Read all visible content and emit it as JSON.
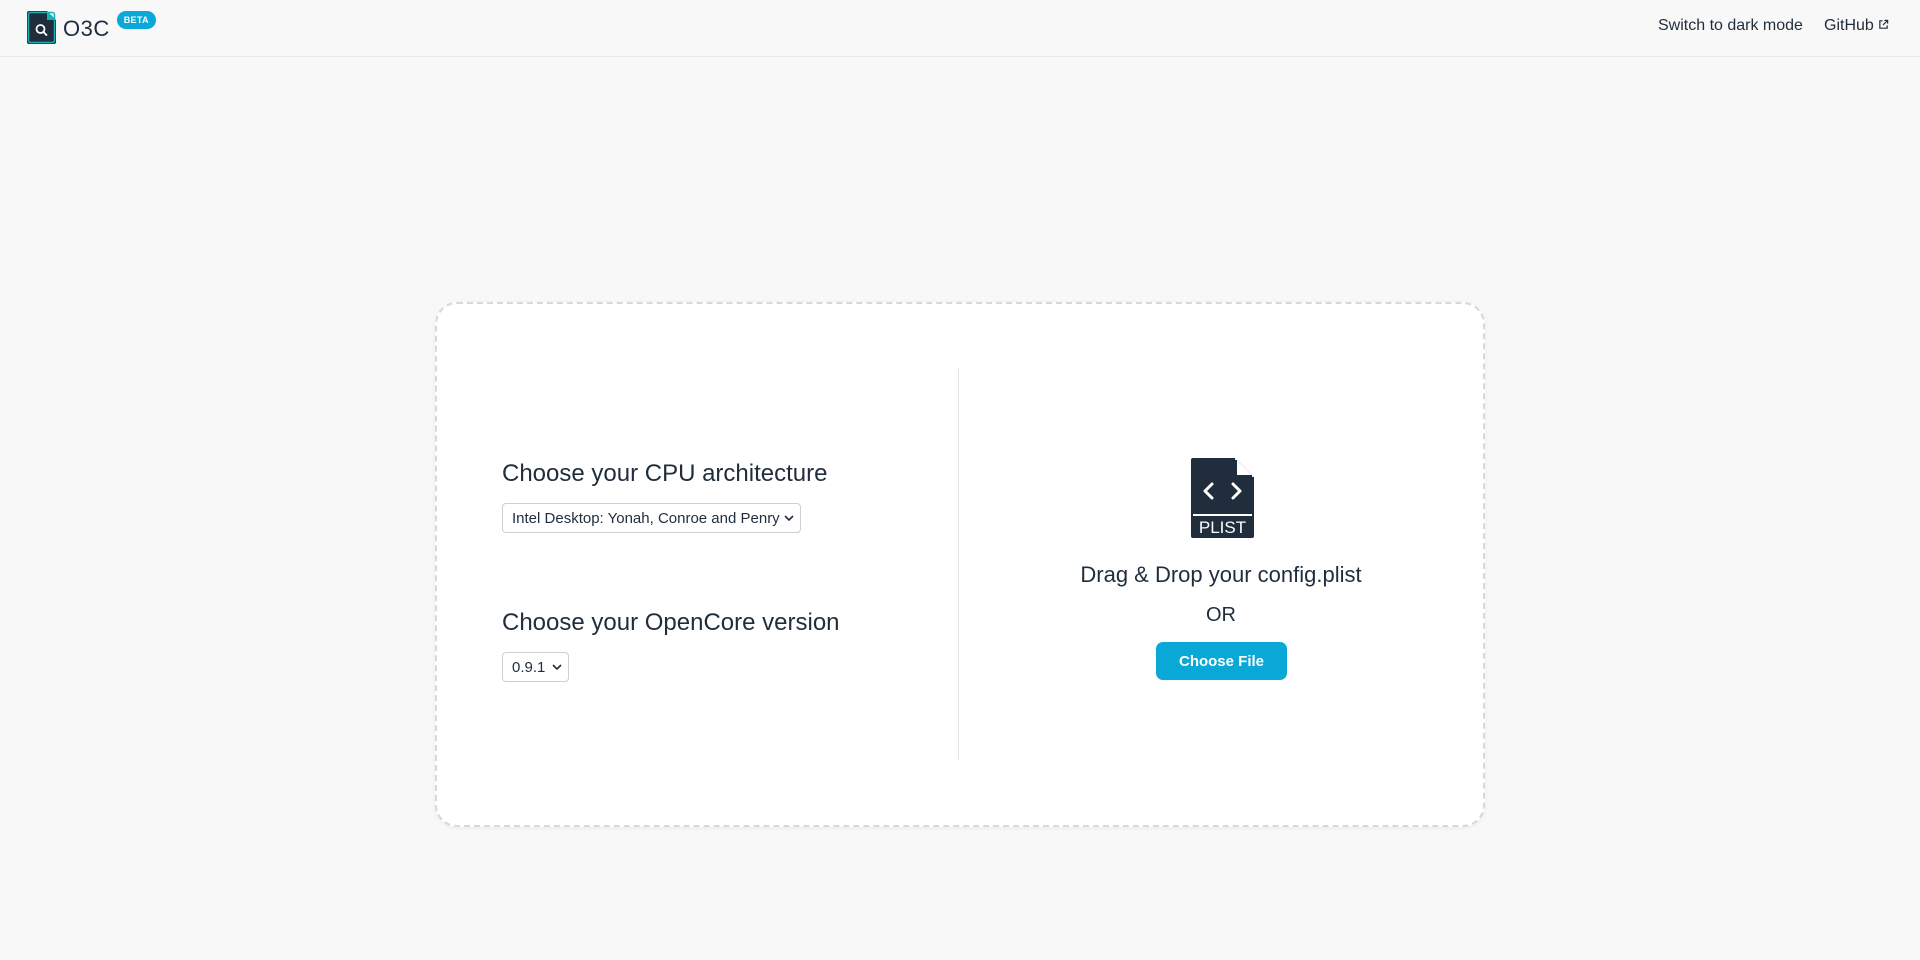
{
  "header": {
    "app_name": "O3C",
    "badge": "BETA",
    "dark_mode_label": "Switch to dark mode",
    "github_label": "GitHub"
  },
  "form": {
    "cpu_label": "Choose your CPU architecture",
    "cpu_selected": "Intel Desktop: Yonah, Conroe and Penryn",
    "opencore_label": "Choose your OpenCore version",
    "opencore_selected": "0.9.1"
  },
  "upload": {
    "icon_text": "PLIST",
    "drag_text": "Drag & Drop your config.plist",
    "or_text": "OR",
    "button_label": "Choose File"
  },
  "icons": {
    "logo": "search-file-icon",
    "external": "external-link-icon",
    "plist": "plist-file-icon",
    "caret": "chevron-down-icon"
  },
  "colors": {
    "accent": "#0aa8d6",
    "text": "#1f2d3d",
    "logo_dark": "#1f2d3d",
    "logo_accent": "#17b3b3",
    "background": "#f8f8f8"
  }
}
